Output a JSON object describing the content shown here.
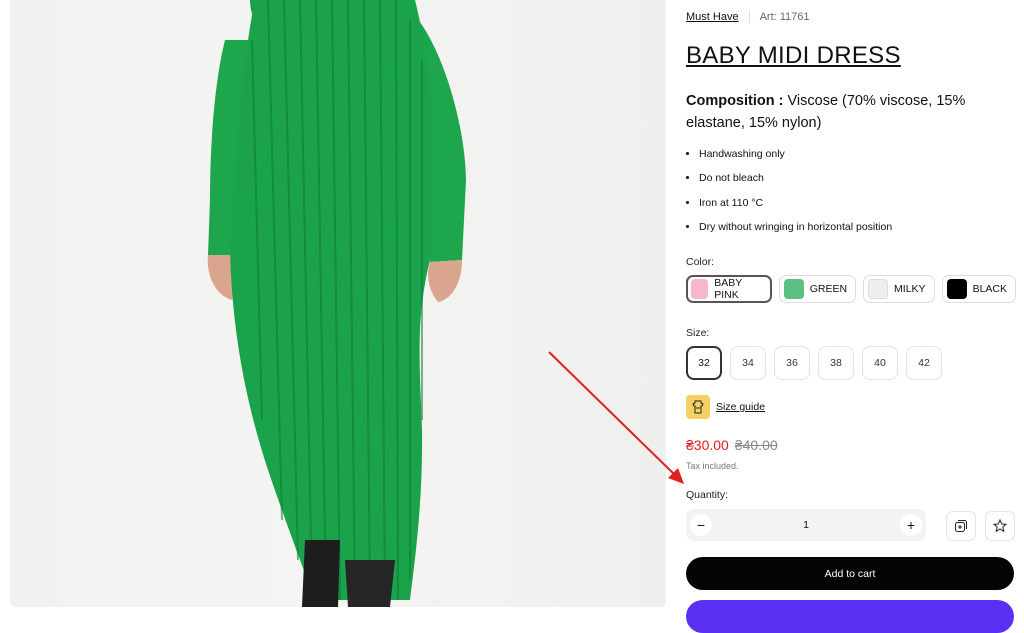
{
  "product": {
    "brand": "Must Have",
    "article": "Art: 11761",
    "title": "BABY MIDI DRESS",
    "composition_label": "Composition :",
    "composition_text": " Viscose (70% viscose, 15% elastane, 15% nylon)",
    "care": [
      "Handwashing only",
      "Do not bleach",
      "Iron at 110 °C",
      "Dry without wringing in horizontal position"
    ]
  },
  "color": {
    "label": "Color:",
    "options": [
      {
        "name": "BABY PINK",
        "hex": "#f8b7c8",
        "selected": true
      },
      {
        "name": "GREEN",
        "hex": "#5dbf82",
        "selected": false
      },
      {
        "name": "MILKY",
        "hex": "#eeeeee",
        "selected": false
      },
      {
        "name": "BLACK",
        "hex": "#000000",
        "selected": false
      }
    ]
  },
  "size": {
    "label": "Size:",
    "options": [
      "32",
      "34",
      "36",
      "38",
      "40",
      "42"
    ],
    "selected": "32",
    "guide": "Size guide"
  },
  "price": {
    "current": "₴30.00",
    "old": "₴40.00",
    "tax": "Tax included."
  },
  "quantity": {
    "label": "Quantity:",
    "value": "1",
    "minus": "−",
    "plus": "+"
  },
  "cart": {
    "label": "Add to cart"
  },
  "colors": {
    "sale": "#e21b1b",
    "annotation_arrow": "#e0201e",
    "buy_now": "#5a31f4",
    "dress": "#1aa24a"
  },
  "icons": {
    "compare": "compare-icon",
    "wishlist": "star-icon",
    "size_guide": "size-guide-icon"
  }
}
